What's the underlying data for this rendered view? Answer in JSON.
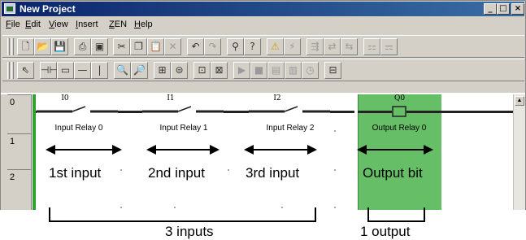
{
  "window": {
    "title": "New Project",
    "min_label": "_",
    "max_label": "□",
    "close_label": "×"
  },
  "menu": {
    "items": [
      "File",
      "Edit",
      "View",
      "Insert",
      "ZEN",
      "Help"
    ]
  },
  "toolbar1_icons": [
    "new-icon",
    "open-icon",
    "save-icon",
    "print-icon",
    "print-preview-icon",
    "cut-icon",
    "copy-icon",
    "paste-icon",
    "delete-icon",
    "undo-icon",
    "redo-icon",
    "find-icon",
    "help-icon",
    "warning-icon",
    "run-icon",
    "transfer-icon",
    "compare-icon",
    "read-icon",
    "connect-icon",
    "disconnect-icon"
  ],
  "toolbar2_icons": [
    "pointer-icon",
    "contact-icon",
    "coil-icon",
    "line-icon",
    "vline-icon",
    "zoom-in-icon",
    "zoom-out-icon",
    "grid-icon",
    "monitor-icon",
    "program-icon",
    "edit-icon",
    "run-mode-icon",
    "stop-icon",
    "view1-icon",
    "view2-icon",
    "clock-icon",
    "settings-icon"
  ],
  "rows": [
    "0",
    "1",
    "2"
  ],
  "ladder": {
    "contacts": [
      {
        "id": "I0",
        "label": "Input Relay 0"
      },
      {
        "id": "I1",
        "label": "Input Relay 1"
      },
      {
        "id": "I2",
        "label": "Input Relay 2"
      }
    ],
    "coil": {
      "id": "Q0",
      "label": "Output Relay 0"
    }
  },
  "overlay": {
    "labels": [
      "1st input",
      "2nd input",
      "3rd input",
      "Output bit"
    ],
    "bracket_inputs": "3 inputs",
    "bracket_output": "1 output"
  },
  "colors": {
    "titlebar": "#0a246a",
    "output_highlight": "#66bf66",
    "power_rail": "#30a030"
  }
}
